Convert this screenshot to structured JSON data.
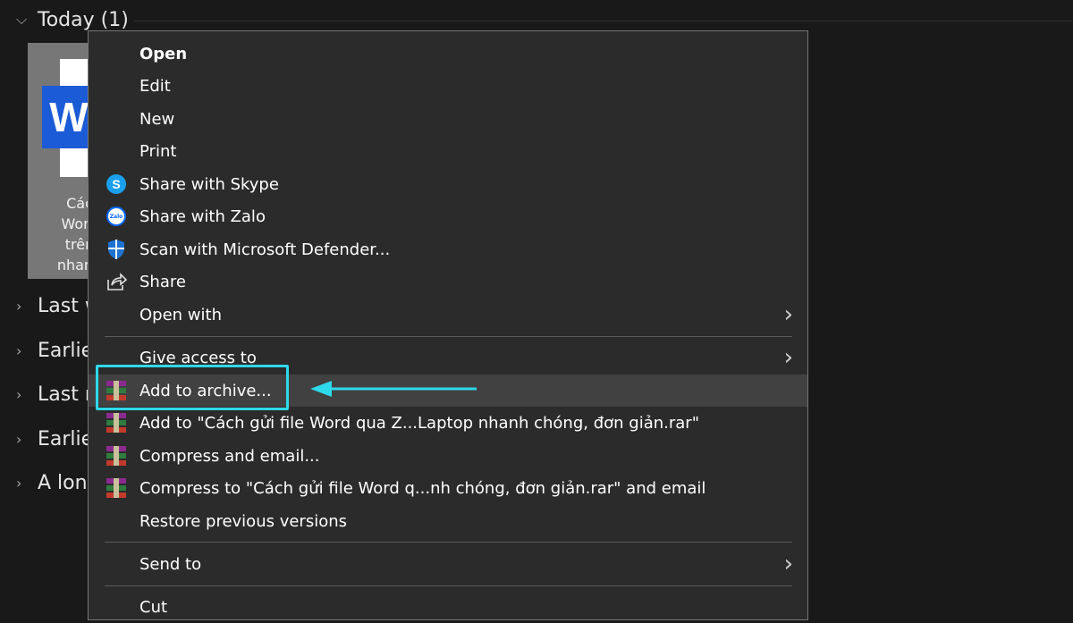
{
  "explorer": {
    "groups": [
      {
        "label": "Today (1)",
        "expanded": true
      },
      {
        "label": "Last w",
        "expanded": false
      },
      {
        "label": "Earlie",
        "expanded": false
      },
      {
        "label": "Last n",
        "expanded": false
      },
      {
        "label": "Earlie",
        "expanded": false
      },
      {
        "label": "A lon",
        "expanded": false
      }
    ],
    "file": {
      "icon": "word-document-icon",
      "badge": "W",
      "name": "Các\nWord\ntrên\nnhanh"
    }
  },
  "context_menu": {
    "items": [
      {
        "label": "Open",
        "bold": true,
        "icon": ""
      },
      {
        "label": "Edit",
        "icon": ""
      },
      {
        "label": "New",
        "icon": ""
      },
      {
        "label": "Print",
        "icon": ""
      },
      {
        "label": "Share with Skype",
        "icon": "skype-icon"
      },
      {
        "label": "Share with Zalo",
        "icon": "zalo-icon",
        "icon_text": "Zalo"
      },
      {
        "label": "Scan with Microsoft Defender...",
        "icon": "defender-shield-icon"
      },
      {
        "label": "Share",
        "icon": "share-icon"
      },
      {
        "label": "Open with",
        "icon": "",
        "submenu": true
      },
      {
        "label": "Give access to",
        "icon": "",
        "submenu": true
      },
      {
        "label": "Add to archive...",
        "icon": "winrar-icon",
        "highlighted": true
      },
      {
        "label": "Add to \"Cách gửi file Word qua Z...Laptop nhanh chóng, đơn giản.rar\"",
        "icon": "winrar-icon"
      },
      {
        "label": "Compress and email...",
        "icon": "winrar-icon"
      },
      {
        "label": "Compress to \"Cách gửi file Word q...nh chóng, đơn giản.rar\" and email",
        "icon": "winrar-icon"
      },
      {
        "label": "Restore previous versions",
        "icon": ""
      },
      {
        "label": "Send to",
        "icon": "",
        "submenu": true
      },
      {
        "label": "Cut",
        "icon": ""
      }
    ]
  },
  "colors": {
    "background": "#191919",
    "menu_background": "#2b2b2b",
    "hover": "#414141",
    "annotation": "#2ed9ea"
  }
}
